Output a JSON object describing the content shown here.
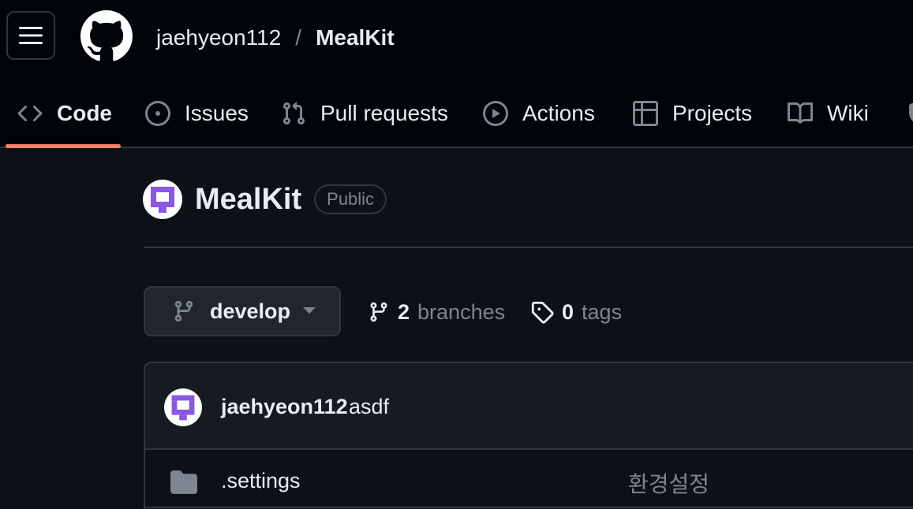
{
  "header": {
    "owner": "jaehyeon112",
    "separator": "/",
    "repo": "MealKit"
  },
  "tabs": [
    {
      "label": "Code",
      "icon": "code-icon",
      "active": true
    },
    {
      "label": "Issues",
      "icon": "issue-icon"
    },
    {
      "label": "Pull requests",
      "icon": "pull-request-icon"
    },
    {
      "label": "Actions",
      "icon": "play-icon"
    },
    {
      "label": "Projects",
      "icon": "table-icon"
    },
    {
      "label": "Wiki",
      "icon": "book-icon"
    }
  ],
  "repo": {
    "name": "MealKit",
    "visibility": "Public"
  },
  "branch": {
    "current": "develop",
    "branches_count": "2",
    "branches_label": "branches",
    "tags_count": "0",
    "tags_label": "tags"
  },
  "latest_commit": {
    "author": "jaehyeon112",
    "message": "asdf"
  },
  "files": [
    {
      "name": ".settings",
      "type": "folder",
      "commit_message": "환경설정"
    }
  ],
  "colors": {
    "accent": "#f78166",
    "background": "#0d1117",
    "header_background": "#010409",
    "avatar_purple": "#8957e5"
  }
}
